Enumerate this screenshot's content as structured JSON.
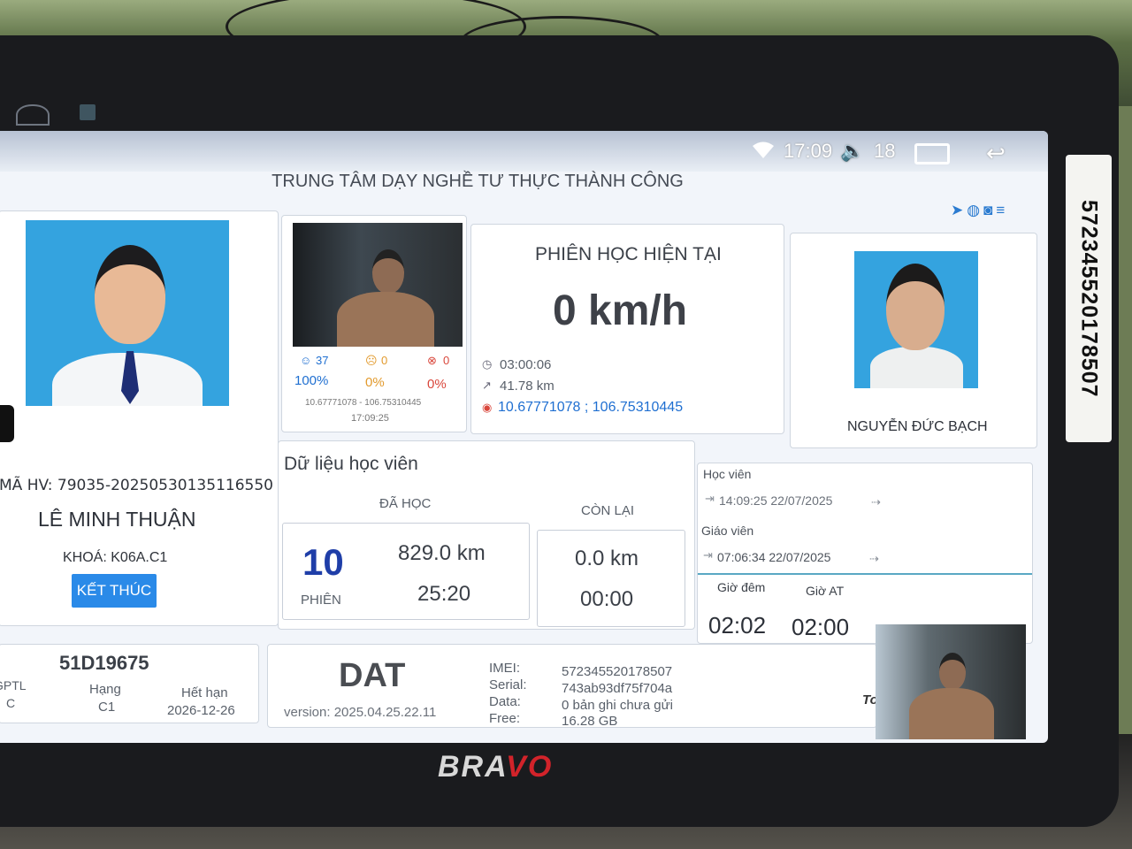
{
  "status_bar": {
    "time": "17:09",
    "volume": "18"
  },
  "header": {
    "center_name": "TRUNG TÂM DẠY NGHỀ TƯ THỰC THÀNH CÔNG"
  },
  "student": {
    "id_label": "MÃ HV:",
    "id_value": "79035-20250530135116550",
    "name": "LÊ MINH THUẬN",
    "course_label": "KHOÁ:",
    "course_value": "K06A.C1",
    "end_button": "KẾT THÚC"
  },
  "camera": {
    "smile_count": "37",
    "warn_count": "0",
    "error_count": "0",
    "smile_pct": "100%",
    "warn_pct": "0%",
    "error_pct": "0%",
    "coords": "10.67771078 - 106.75310445",
    "time": "17:09:25"
  },
  "session": {
    "title": "PHIÊN HỌC HIỆN TẠI",
    "speed": "0 km/h",
    "duration": "03:00:06",
    "distance": "41.78 km",
    "gps": "10.67771078 ; 106.75310445"
  },
  "teacher": {
    "name": "NGUYỄN ĐỨC BẠCH"
  },
  "student_data": {
    "title": "Dữ liệu học viên",
    "learned_label": "ĐÃ HỌC",
    "remaining_label": "CÒN LẠI",
    "sessions": "10",
    "sessions_label": "PHIÊN",
    "learned_km": "829.0 km",
    "learned_time": "25:20",
    "remaining_km": "0.0 km",
    "remaining_time": "00:00"
  },
  "login": {
    "student_label": "Học viên",
    "student_time": "14:09:25 22/07/2025",
    "teacher_label": "Giáo viên",
    "teacher_time": "07:06:34 22/07/2025",
    "night_label": "Giờ đêm",
    "at_label": "Giờ AT",
    "night_value": "02:02",
    "at_value": "02:00",
    "cut_text": "To"
  },
  "vehicle": {
    "plate": "51D19675",
    "gptl_label": "GPTL",
    "gptl_value": "C",
    "class_label": "Hạng",
    "class_value": "C1",
    "expiry_label": "Hết hạn",
    "expiry_value": "2026-12-26"
  },
  "device": {
    "name": "DAT",
    "version": "version: 2025.04.25.22.11",
    "imei_label": "IMEI:",
    "imei_value": "572345520178507",
    "serial_label": "Serial:",
    "serial_value": "743ab93df75f704a",
    "data_label": "Data:",
    "data_value": "0 bản ghi chưa gửi",
    "free_label": "Free:",
    "free_value": "16.28 GB"
  },
  "hardware": {
    "brand_left": "BRA",
    "brand_right": "VO",
    "side_serial": "572345520178507"
  },
  "icons": [
    "home-icon",
    "image-icon",
    "wifi-icon",
    "volume-icon",
    "recent-apps-icon",
    "back-icon",
    "navigation-icon",
    "globe-icon",
    "camera-icon",
    "database-icon",
    "smile-icon",
    "warning-face-icon",
    "error-icon",
    "clock-icon",
    "route-icon",
    "gps-icon",
    "login-icon",
    "logout-icon"
  ],
  "colors": {
    "accent": "#2a8ae8",
    "photo_bg": "#34a3df",
    "session_number": "#1f3ea8"
  }
}
